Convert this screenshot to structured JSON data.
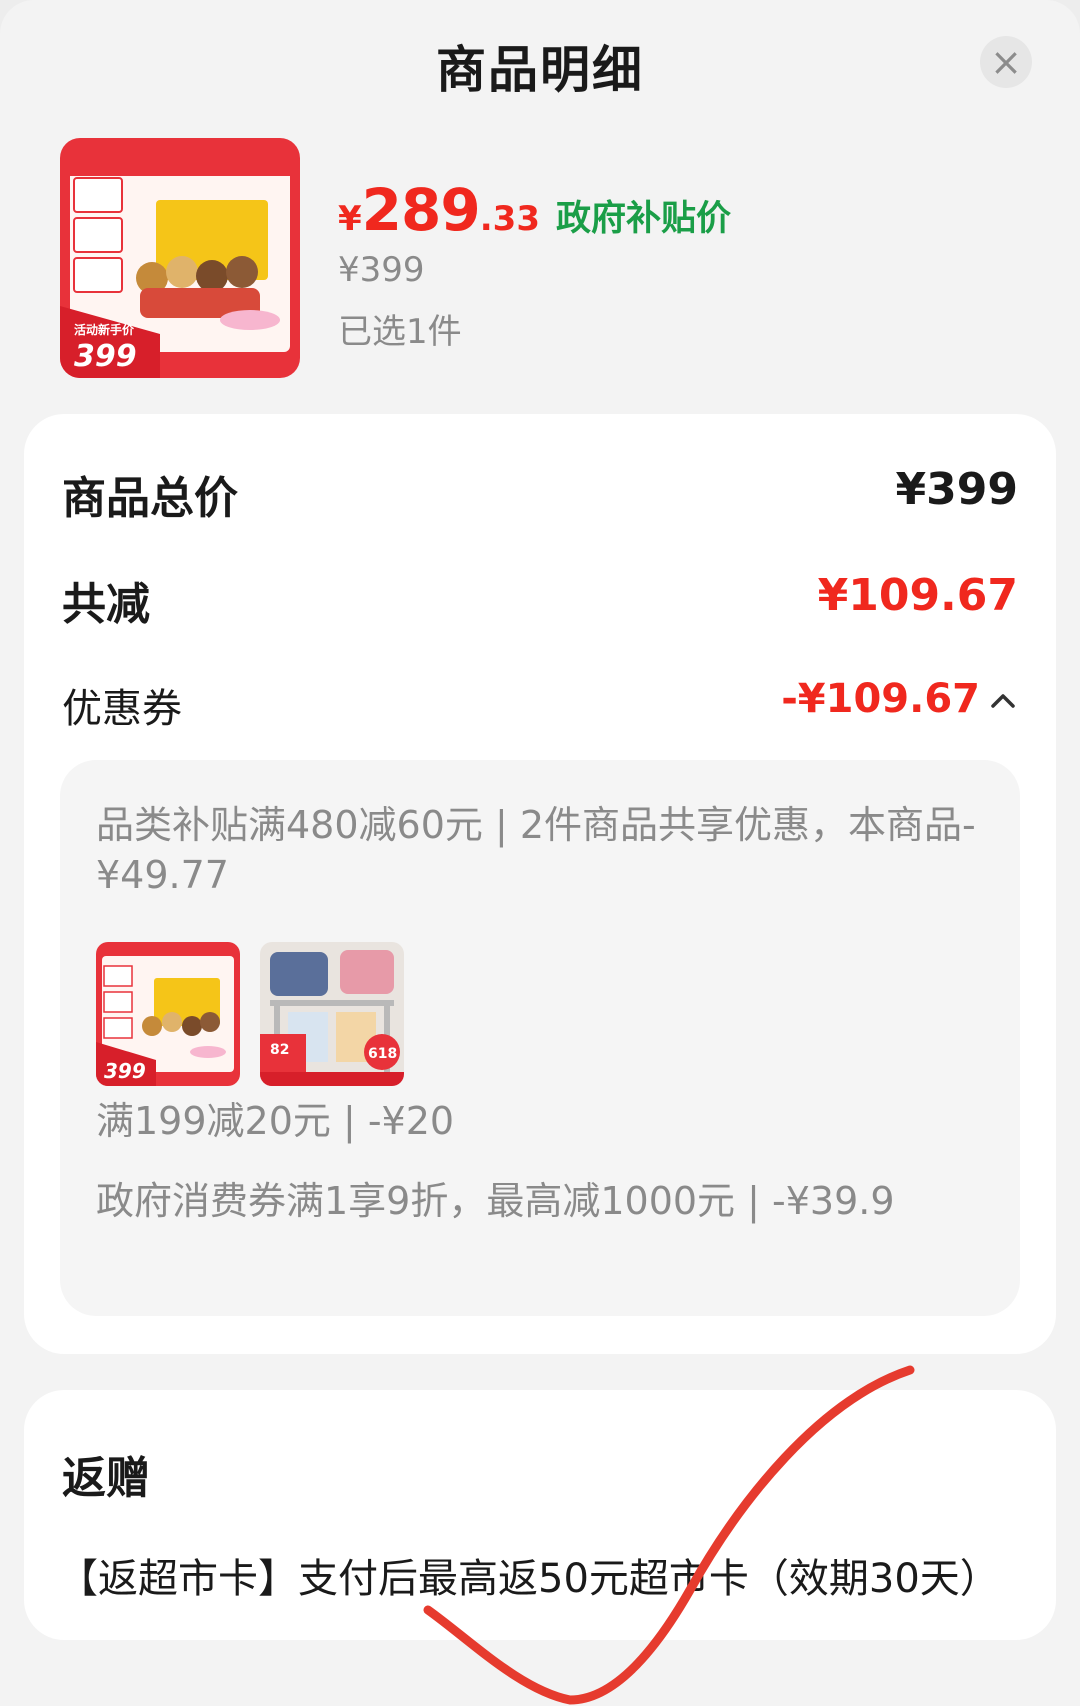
{
  "header": {
    "title": "商品明细",
    "close_icon": "close-icon"
  },
  "product": {
    "currency": "¥",
    "price_main": "289",
    "price_decimal": ".33",
    "price_tag": "政府补贴价",
    "original_price": "¥399",
    "selected_count": "已选1件",
    "image": {
      "badge_label": "活动新手价",
      "badge_price": "399"
    }
  },
  "summary": {
    "total_label": "商品总价",
    "total_value": "¥399",
    "discount_label": "共减",
    "discount_value": "¥109.67",
    "coupon_label": "优惠券",
    "coupon_value": "-¥109.67"
  },
  "coupon_details": {
    "item1": "品类补贴满480减60元 | 2件商品共享优惠，本商品-¥49.77",
    "thumbnails": [
      {
        "badge_price": "399",
        "name": "toy-product-thumbnail"
      },
      {
        "badge_number": "82",
        "badge_text": "618",
        "name": "backpack-product-thumbnail"
      }
    ],
    "item2": "满199减20元 | -¥20",
    "item3": "政府消费券满1享9折，最高减1000元 | -¥39.9"
  },
  "gift": {
    "title": "返赠",
    "description": "【返超市卡】支付后最高返50元超市卡（效期30天）"
  },
  "colors": {
    "accent_red": "#f0281e",
    "accent_green": "#1a9e47",
    "sheet_bg": "#f3f3f3"
  }
}
